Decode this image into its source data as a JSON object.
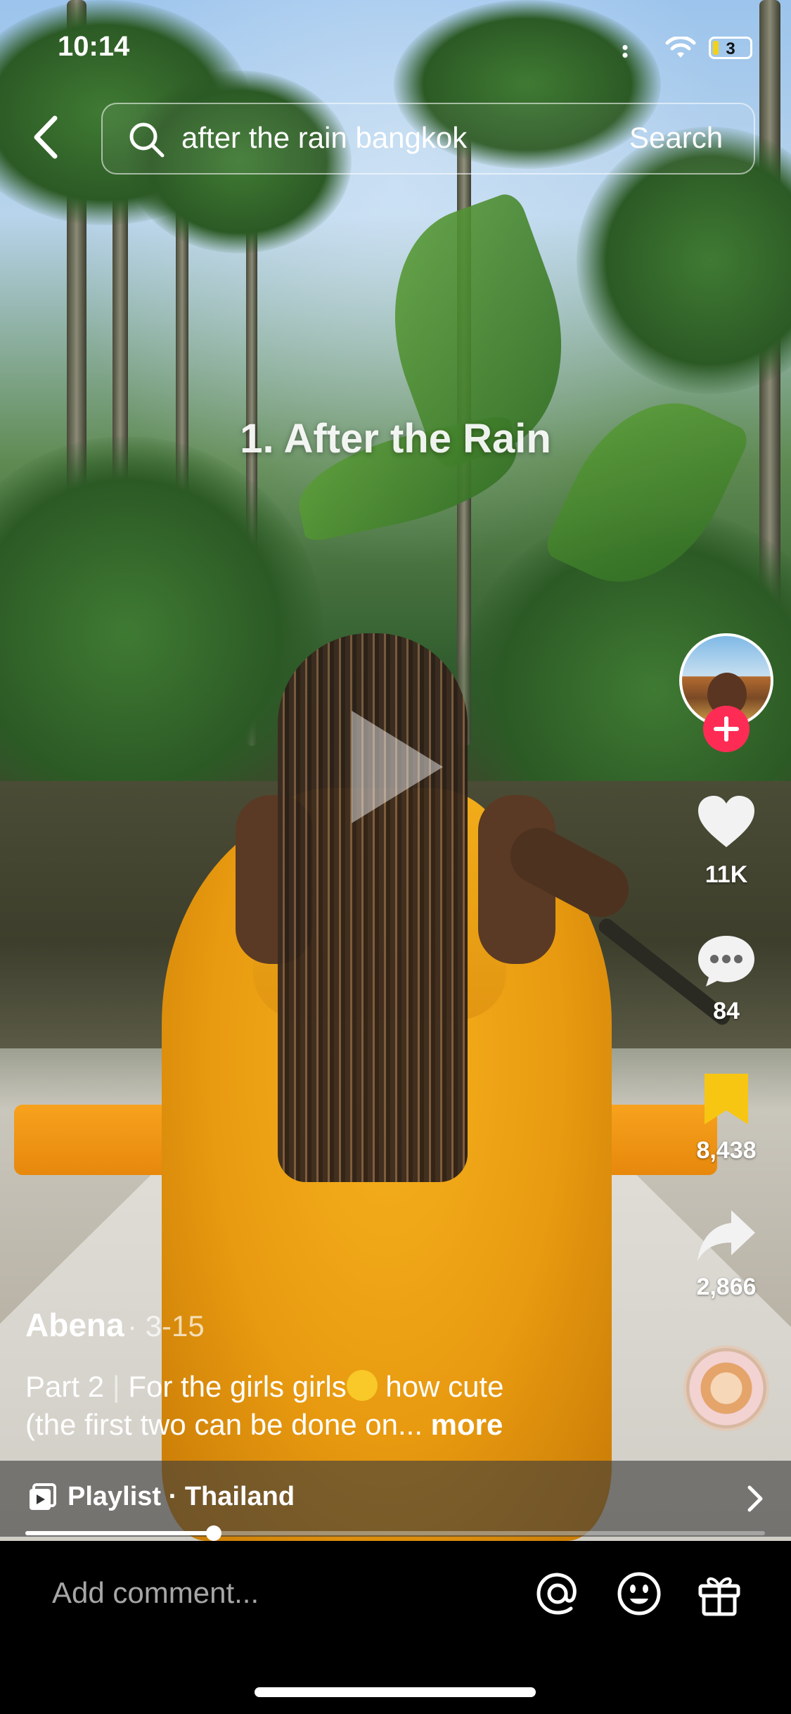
{
  "status_bar": {
    "time": "10:14",
    "battery_level": "3",
    "battery_fraction": 0.15
  },
  "search": {
    "query": "after the rain bangkok",
    "button_label": "Search"
  },
  "video": {
    "overlay_title": "1. After the Rain"
  },
  "actions": {
    "likes": "11K",
    "comments": "84",
    "bookmarks": "8,438",
    "shares": "2,866"
  },
  "post": {
    "author": "Abena",
    "date": "· 3-15",
    "caption_part": "Part 2",
    "caption_sep": "|",
    "caption_line1": "For the girls girls",
    "caption_line1_end": " how cute",
    "caption_line2": "(the first two can be done on...",
    "more_label": "more"
  },
  "playlist": {
    "label": "Playlist · Thailand"
  },
  "progress": {
    "fraction": 0.255
  },
  "comment_bar": {
    "placeholder": "Add comment..."
  },
  "colors": {
    "follow": "#fe2c55",
    "bookmark": "#f7c613",
    "battery": "#f2d21a"
  },
  "icons": [
    "back-chevron-icon",
    "search-icon",
    "heart-icon",
    "comment-icon",
    "bookmark-icon",
    "share-icon",
    "playlist-icon",
    "chevron-right-icon",
    "mention-icon",
    "emoji-icon",
    "gift-icon"
  ]
}
